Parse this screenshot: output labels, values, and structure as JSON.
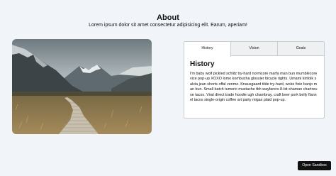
{
  "about": {
    "title": "About",
    "subtitle": "Lorem ipsum dolor sit amet consectetur adipisicing elit. Earum, aperiam!"
  },
  "image": {
    "icon": "mountain-boardwalk-photo"
  },
  "tabs": [
    {
      "label": "History",
      "active": true
    },
    {
      "label": "Vision",
      "active": false
    },
    {
      "label": "Goals",
      "active": false
    }
  ],
  "panel": {
    "title": "History",
    "text": "I'm baby wolf pickled schlitz try-hard normcore marfa man bun mumblecore vice pop-up XOXO lomo kombucha glossier bicycle rights. Umami kinfolk salvia jean shorts offal venmo. Knausgaard tilde try-hard, woke fixie banjo man bun. Small batch tumeric mustache tbh wayfarers 8-bit shaman chartreuse tacos. Viral direct trade hoodie ugh chambray, craft beer pork belly flannel tacos single-origin coffee art party migas plaid pop-up."
  },
  "sandbox_button": {
    "label": "Open Sandbox"
  }
}
